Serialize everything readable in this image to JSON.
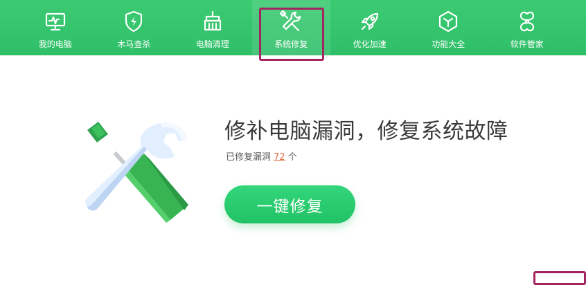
{
  "nav": {
    "items": [
      {
        "label": "我的电脑",
        "icon": "monitor-icon"
      },
      {
        "label": "木马查杀",
        "icon": "shield-bolt-icon"
      },
      {
        "label": "电脑清理",
        "icon": "broom-icon"
      },
      {
        "label": "系统修复",
        "icon": "wrench-screwdriver-icon",
        "active": true
      },
      {
        "label": "优化加速",
        "icon": "rocket-icon"
      },
      {
        "label": "功能大全",
        "icon": "cube-icon"
      },
      {
        "label": "软件管家",
        "icon": "apps-grid-icon"
      }
    ]
  },
  "main": {
    "headline": "修补电脑漏洞，修复系统故障",
    "sub_prefix": "已修复漏洞",
    "fixed_count": "72",
    "sub_suffix": "个",
    "repair_button": "一键修复"
  },
  "colors": {
    "brand_green": "#2fbf68",
    "button_green": "#22c265",
    "highlight_box": "#a3245f",
    "count_orange": "#e26a3d"
  }
}
